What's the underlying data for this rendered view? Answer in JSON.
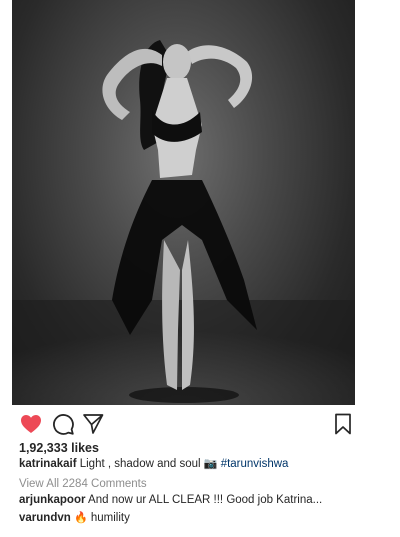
{
  "post": {
    "image_icon": "black-and-white-photo"
  },
  "actions": {
    "like_icon": "heart-filled-icon",
    "like_color": "#ed4956",
    "comment_icon": "comment-bubble-icon",
    "share_icon": "paper-plane-icon",
    "save_icon": "bookmark-icon"
  },
  "likes": {
    "text": "1,92,333 likes"
  },
  "caption": {
    "username": "katrinakaif",
    "text": "Light , shadow and soul",
    "emoji": "📷",
    "hashtag": "#tarunvishwa"
  },
  "comments": {
    "view_all": "View All 2284 Comments",
    "items": [
      {
        "username": "arjunkapoor",
        "text": "And now ur ALL CLEAR !!! Good job Katrina..."
      },
      {
        "username": "varundvn",
        "emoji": "🔥",
        "text": "humility"
      }
    ]
  }
}
